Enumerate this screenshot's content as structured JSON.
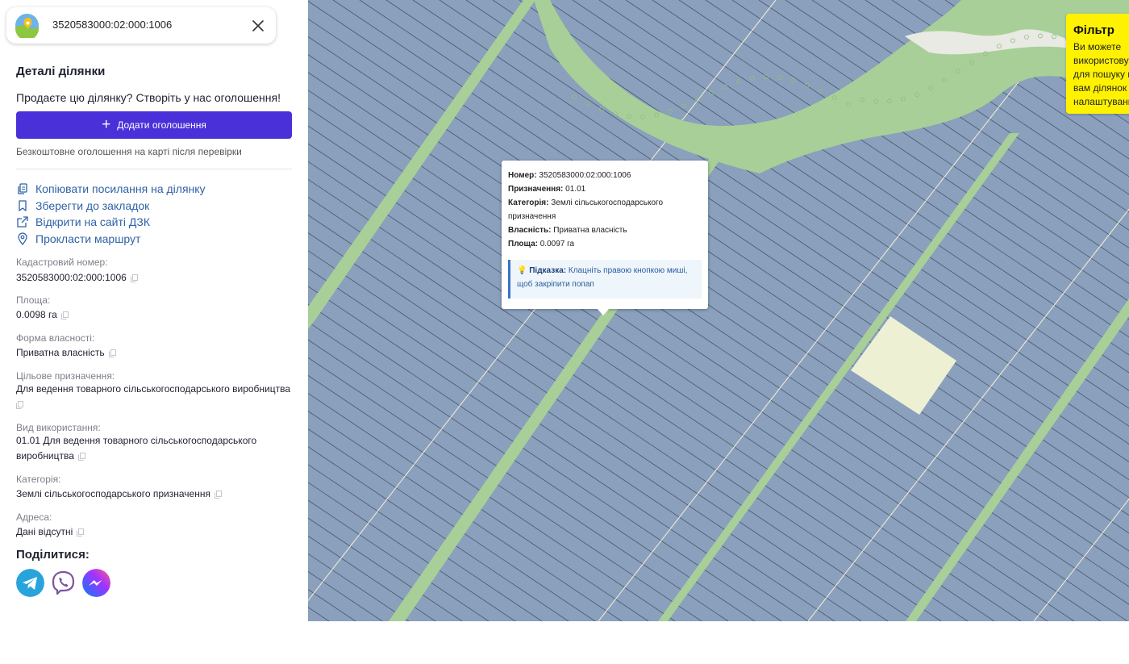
{
  "search": {
    "value": "3520583000:02:000:1006",
    "close_icon": "close-icon",
    "logo_icon": "map-logo-icon"
  },
  "panel": {
    "title": "Деталі ділянки",
    "sell_prompt": "Продаєте цю ділянку? Створіть у нас оголошення!",
    "add_button_label": "Додати оголошення",
    "free_note": "Безкоштовне оголошення на карті після перевірки",
    "actions": [
      {
        "label": "Копіювати посилання на ділянку",
        "icon": "copy-link-icon"
      },
      {
        "label": "Зберегти до закладок",
        "icon": "bookmark-icon"
      },
      {
        "label": "Відкрити на сайті ДЗК",
        "icon": "external-link-icon"
      },
      {
        "label": "Прокласти маршрут",
        "icon": "location-pin-icon"
      }
    ],
    "fields": [
      {
        "label": "Кадастровий номер:",
        "value": "3520583000:02:000:1006"
      },
      {
        "label": "Площа:",
        "value": "0.0098 га"
      },
      {
        "label": "Форма власності:",
        "value": "Приватна власність"
      },
      {
        "label": "Цільове призначення:",
        "value": "Для ведення товарного сільськогосподарського виробництва"
      },
      {
        "label": "Вид використання:",
        "value": "01.01 Для ведення товарного сільськогосподарського виробництва"
      },
      {
        "label": "Категорія:",
        "value": "Землі сільськогосподарського призначення"
      },
      {
        "label": "Адреса:",
        "value": "Дані відсутні"
      }
    ],
    "share_title": "Поділитися:",
    "share_icons": [
      "telegram-icon",
      "viber-icon",
      "messenger-icon"
    ]
  },
  "popup": {
    "number_label": "Номер:",
    "number_value": "3520583000:02:000:1006",
    "purpose_label": "Призначення:",
    "purpose_value": "01.01",
    "category_label": "Категорія:",
    "category_value": "Землі сільськогосподарського призначення",
    "ownership_label": "Власність:",
    "ownership_value": "Приватна власність",
    "area_label": "Площа:",
    "area_value": "0.0097 га",
    "hint_label": "Підказка:",
    "hint_text": "Клацніть правою кнопкою миші, щоб закріпити попап"
  },
  "filter": {
    "title": "Фільтр",
    "text": "Ви можете\nвикористову\nдля пошуку к\nвам ділянок\nналаштуванн"
  },
  "colors": {
    "accent": "#4a30d9",
    "link": "#2f62a6",
    "parcel": "#8aa0bd",
    "strip": "#a8cf98",
    "highlight": "#eef0d4",
    "filter_bg": "#fff200"
  }
}
